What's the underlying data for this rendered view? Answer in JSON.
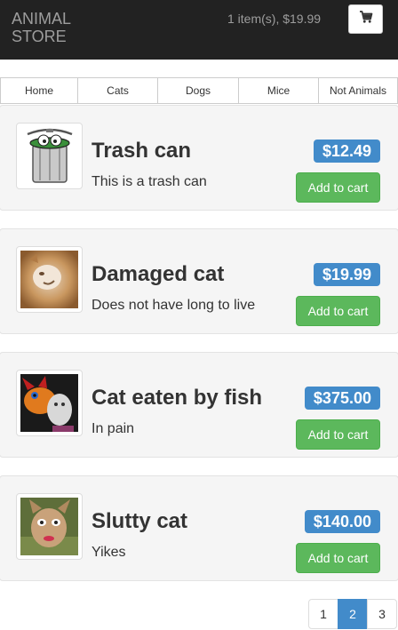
{
  "navbar": {
    "brand": "ANIMAL STORE",
    "cart_summary": "1 item(s), $19.99",
    "cart_icon": "shopping-cart-icon"
  },
  "categories": [
    "Home",
    "Cats",
    "Dogs",
    "Mice",
    "Not Animals"
  ],
  "products": [
    {
      "name": "Trash can",
      "description": "This is a trash can",
      "price": "$12.49",
      "button": "Add to cart",
      "image": "trash-can-image"
    },
    {
      "name": "Damaged cat",
      "description": "Does not have long to live",
      "price": "$19.99",
      "button": "Add to cart",
      "image": "damaged-cat-image"
    },
    {
      "name": "Cat eaten by fish",
      "description": "In pain",
      "price": "$375.00",
      "button": "Add to cart",
      "image": "cat-eaten-by-fish-image"
    },
    {
      "name": "Slutty cat",
      "description": "Yikes",
      "price": "$140.00",
      "button": "Add to cart",
      "image": "slutty-cat-image"
    }
  ],
  "pagination": {
    "pages": [
      "1",
      "2",
      "3"
    ],
    "active": "2"
  },
  "colors": {
    "navbar": "#222222",
    "price_badge": "#428bca",
    "add_button": "#5cb85c",
    "active_page": "#428bca"
  }
}
